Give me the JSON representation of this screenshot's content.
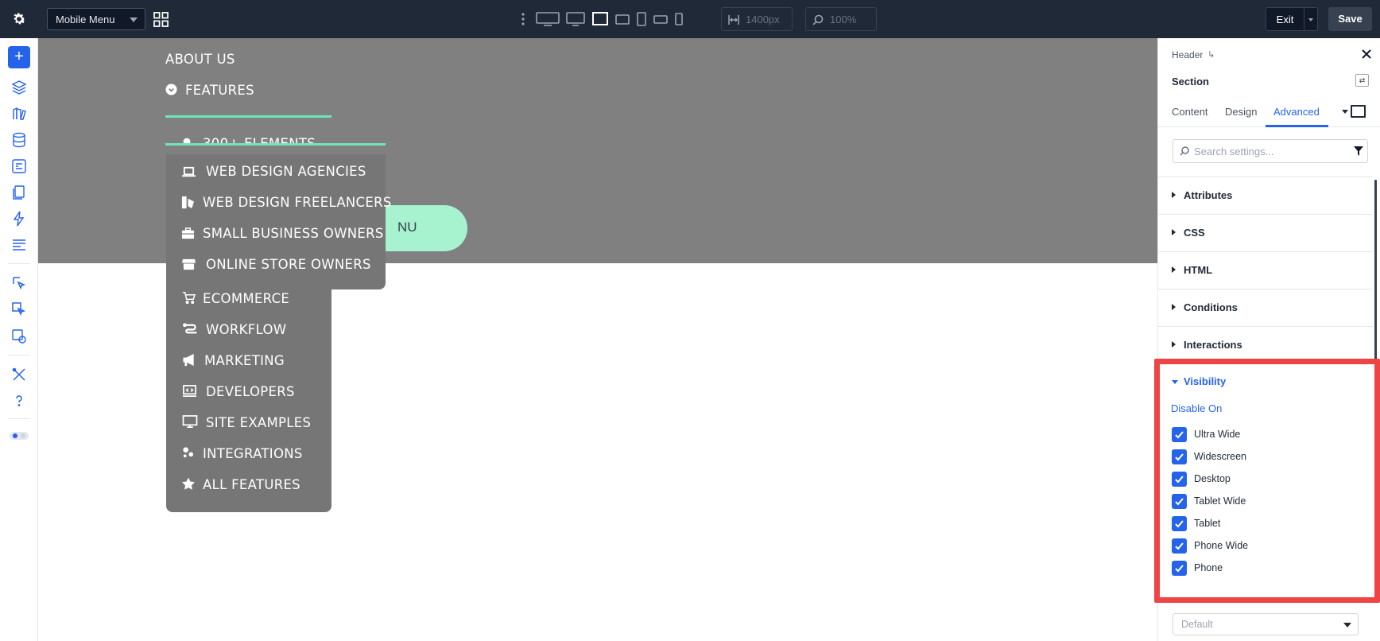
{
  "topbar": {
    "menu_select": "Mobile Menu",
    "width_value": "1400px",
    "zoom_value": "100%",
    "exit_label": "Exit",
    "save_label": "Save",
    "icons": [
      "gear-icon",
      "grid-icon",
      "more-vertical-icon",
      "ultra-wide-icon",
      "widescreen-icon",
      "desktop-icon",
      "tablet-wide-icon",
      "tablet-icon",
      "phone-wide-icon",
      "phone-icon",
      "width-icon",
      "zoom-icon"
    ]
  },
  "sidebar": {
    "icons": [
      "add-icon",
      "layers-icon",
      "templates-icon",
      "database-icon",
      "forms-icon",
      "pages-icon",
      "interactions-icon",
      "settings-list-icon",
      "cursor-select-icon",
      "cursor-multi-icon",
      "components-icon",
      "tools-icon",
      "help-icon",
      "toggle-icon"
    ]
  },
  "canvas": {
    "menu_items": [
      {
        "label": "ABOUT US",
        "icon": "none"
      },
      {
        "label": "FEATURES",
        "icon": "arrow-circle-down-icon"
      },
      {
        "label": "300+ ELEMENTS",
        "icon": "gear-icon"
      }
    ],
    "submenu_primary": [
      {
        "label": "WEB DESIGN AGENCIES",
        "icon": "laptop-icon"
      },
      {
        "label": "WEB DESIGN FREELANCERS",
        "icon": "tools-icon"
      },
      {
        "label": "SMALL BUSINESS OWNERS",
        "icon": "briefcase-icon"
      },
      {
        "label": "ONLINE STORE OWNERS",
        "icon": "store-icon"
      }
    ],
    "submenu_secondary": [
      {
        "label": "ECOMMERCE",
        "icon": "cart-icon"
      },
      {
        "label": "WORKFLOW",
        "icon": "workflow-icon"
      },
      {
        "label": "MARKETING",
        "icon": "megaphone-icon"
      },
      {
        "label": "DEVELOPERS",
        "icon": "code-icon"
      },
      {
        "label": "SITE EXAMPLES",
        "icon": "monitor-icon"
      },
      {
        "label": "INTEGRATIONS",
        "icon": "puzzle-icon"
      },
      {
        "label": "ALL FEATURES",
        "icon": "star-icon"
      }
    ],
    "pill_partial_text": "NU"
  },
  "panel": {
    "breadcrumb": "Header",
    "title": "Section",
    "tabs": [
      "Content",
      "Design",
      "Advanced"
    ],
    "active_tab": "Advanced",
    "search_placeholder": "Search settings...",
    "sections": [
      "Attributes",
      "CSS",
      "HTML",
      "Conditions",
      "Interactions"
    ],
    "visibility": {
      "label": "Visibility",
      "disable_on_label": "Disable On",
      "options": [
        {
          "label": "Ultra Wide",
          "checked": true
        },
        {
          "label": "Widescreen",
          "checked": true
        },
        {
          "label": "Desktop",
          "checked": true
        },
        {
          "label": "Tablet Wide",
          "checked": true
        },
        {
          "label": "Tablet",
          "checked": true
        },
        {
          "label": "Phone Wide",
          "checked": true
        },
        {
          "label": "Phone",
          "checked": true
        }
      ]
    },
    "select_value": "Default"
  },
  "colors": {
    "accent": "#2563eb",
    "topbar_bg": "#1f2937",
    "canvas_header": "#808080",
    "submenu_bg": "#767676",
    "mint": "#6ee7b7",
    "highlight": "#ef4444"
  }
}
